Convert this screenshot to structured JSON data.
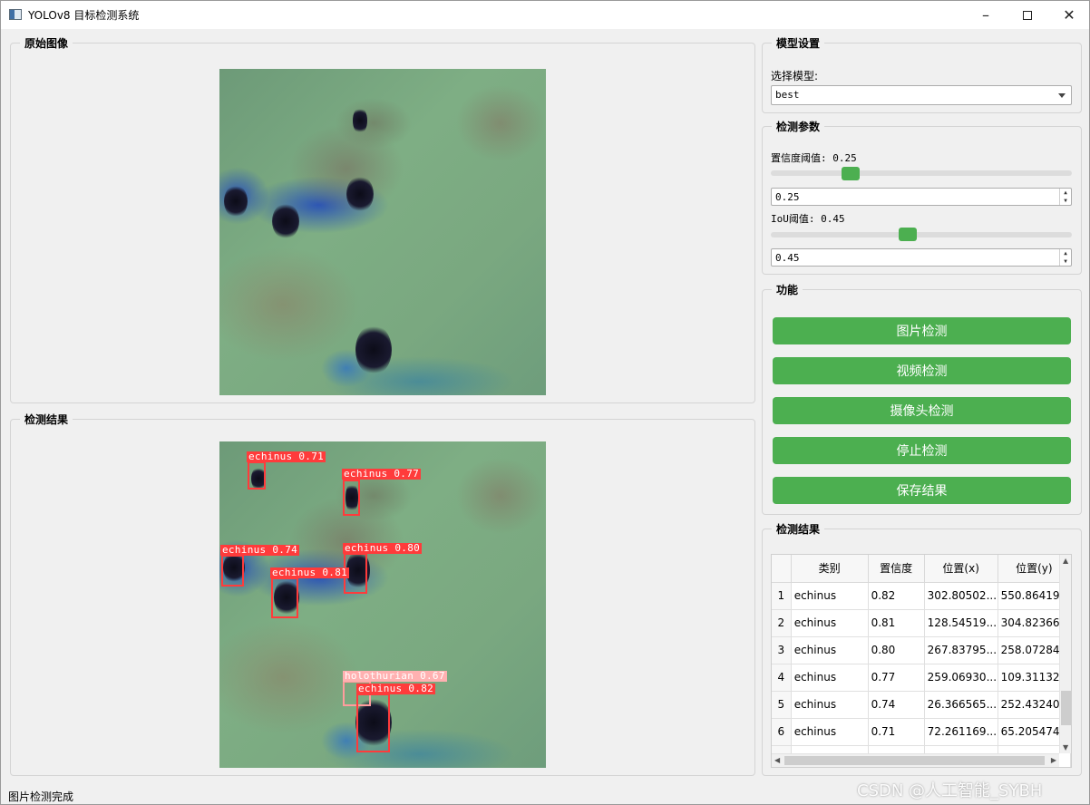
{
  "window": {
    "title": "YOLOv8 目标检测系统"
  },
  "original_panel": {
    "title": "原始图像"
  },
  "result_panel": {
    "title": "检测结果",
    "detections": [
      {
        "label": "echinus 0.71",
        "color": "#ff3b3b"
      },
      {
        "label": "echinus 0.77",
        "color": "#ff3b3b"
      },
      {
        "label": "echinus 0.74",
        "color": "#ff3b3b"
      },
      {
        "label": "echinus 0.80",
        "color": "#ff3b3b"
      },
      {
        "label": "echinus 0.81",
        "color": "#ff3b3b"
      },
      {
        "label": "holothurian 0.67",
        "color": "#ffb1b1"
      },
      {
        "label": "echinus 0.82",
        "color": "#ff3b3b"
      }
    ]
  },
  "model_settings": {
    "title": "模型设置",
    "select_label": "选择模型:",
    "selected_model": "best"
  },
  "detection_params": {
    "title": "检测参数",
    "confidence": {
      "label": "置信度阈值: 0.25",
      "value": "0.25",
      "fraction": 0.25
    },
    "iou": {
      "label": "IoU阈值: 0.45",
      "value": "0.45",
      "fraction": 0.45
    }
  },
  "functions": {
    "title": "功能",
    "image_detect": "图片检测",
    "video_detect": "视频检测",
    "camera_detect": "摄像头检测",
    "stop_detect": "停止检测",
    "save_result": "保存结果"
  },
  "results_table": {
    "title": "检测结果",
    "headers": [
      "类别",
      "置信度",
      "位置(x)",
      "位置(y)"
    ],
    "rows": [
      {
        "num": "1",
        "cls": "echinus",
        "conf": "0.82",
        "x": "302.80502...",
        "y": "550.86419..."
      },
      {
        "num": "2",
        "cls": "echinus",
        "conf": "0.81",
        "x": "128.54519...",
        "y": "304.82366..."
      },
      {
        "num": "3",
        "cls": "echinus",
        "conf": "0.80",
        "x": "267.83795...",
        "y": "258.07284..."
      },
      {
        "num": "4",
        "cls": "echinus",
        "conf": "0.77",
        "x": "259.06930...",
        "y": "109.31132..."
      },
      {
        "num": "5",
        "cls": "echinus",
        "conf": "0.74",
        "x": "26.366565...",
        "y": "252.43240..."
      },
      {
        "num": "6",
        "cls": "echinus",
        "conf": "0.71",
        "x": "72.261169...",
        "y": "65.205474..."
      }
    ]
  },
  "status_bar": {
    "text": "图片检测完成"
  },
  "watermark": {
    "text": "CSDN @人工智能_SYBH"
  }
}
